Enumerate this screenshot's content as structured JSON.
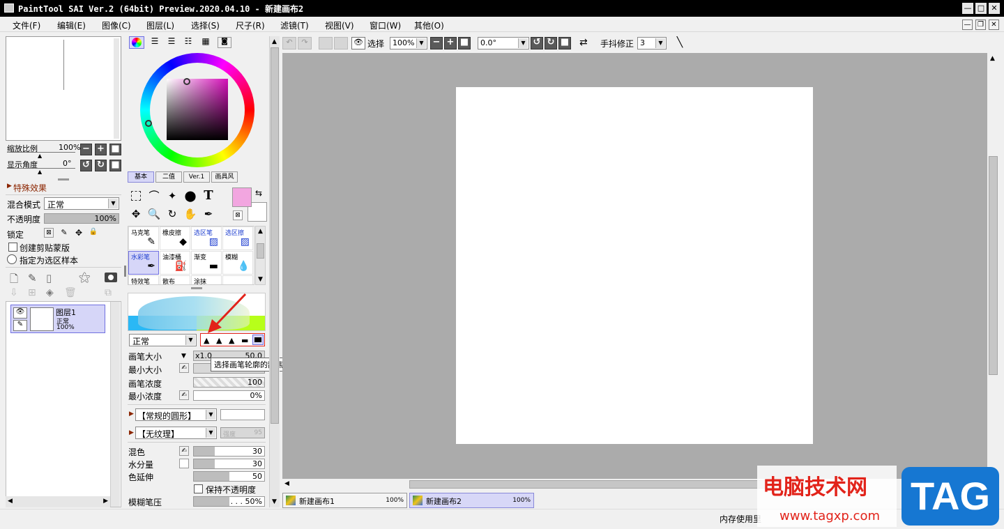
{
  "window": {
    "title": "PaintTool SAI Ver.2 (64bit) Preview.2020.04.10 - 新建画布2",
    "min": "—",
    "max": "□",
    "close": "✕"
  },
  "menu": [
    "文件(F)",
    "编辑(E)",
    "图像(C)",
    "图层(L)",
    "选择(S)",
    "尺子(R)",
    "滤镜(T)",
    "视图(V)",
    "窗口(W)",
    "其他(O)"
  ],
  "navigator": {
    "zoom_label": "缩放比例",
    "zoom_value": "100%",
    "angle_label": "显示角度",
    "angle_value": "0°"
  },
  "layer_panel": {
    "effects_label": "特殊效果",
    "blend_label": "混合模式",
    "blend_value": "正常",
    "opacity_label": "不透明度",
    "opacity_value": "100%",
    "opacity_level": 1.0,
    "lock_label": "锁定",
    "clip_label": "创建剪贴蒙版",
    "selection_source_label": "指定为选区样本",
    "layer": {
      "name": "图层1",
      "mode": "正常",
      "opacity": "100%"
    }
  },
  "color_panel": {
    "tabs": [
      "基本",
      "二值",
      "Ver.1",
      "画具风"
    ],
    "primary_color": "#f2a6e0",
    "secondary_color": "#ffffff"
  },
  "brushes": [
    {
      "label": "马克笔",
      "icon": "✎"
    },
    {
      "label": "橡皮擦",
      "icon": "◆"
    },
    {
      "label": "选区笔",
      "icon": "▨"
    },
    {
      "label": "选区擦",
      "icon": "▨"
    },
    {
      "label": "水彩笔",
      "icon": "✒"
    },
    {
      "label": "油漆桶",
      "icon": "⛽"
    },
    {
      "label": "渐变",
      "icon": "▬"
    },
    {
      "label": "模糊",
      "icon": "💧"
    },
    {
      "label": "特效笔",
      "icon": "✎"
    },
    {
      "label": "散布",
      "icon": "·"
    },
    {
      "label": "涂抹",
      "icon": "☜"
    },
    {
      "label": "",
      "icon": ""
    }
  ],
  "brush_settings": {
    "mode_value": "正常",
    "size_label": "画笔大小",
    "size_mult": "x1.0",
    "size_value": "50.0",
    "min_size_label": "最小大小",
    "density_label": "画笔浓度",
    "density_value": "100",
    "density_level": 1.0,
    "min_density_label": "最小浓度",
    "min_density_value": "0%",
    "shape_value": "【常规的圆形】",
    "texture_value": "【无纹理】",
    "texture_strength_label": "强度",
    "texture_strength_value": "95",
    "blend_label": "混色",
    "blend_value": "30",
    "blend_level": 0.3,
    "water_label": "水分量",
    "water_value": "30",
    "water_level": 0.3,
    "stretch_label": "色延伸",
    "stretch_value": "50",
    "stretch_level": 0.5,
    "keep_opacity_label": "保持不透明度",
    "blur_label": "模糊笔压",
    "blur_value": ". . . 50%",
    "blur_level": 0.5,
    "tooltip": "选择画笔轮廓的散焦程度。"
  },
  "toolbar": {
    "selection_label": "选择",
    "zoom_value": "100%",
    "angle_value": "0.0°",
    "stabilizer_label": "手抖修正",
    "stabilizer_value": "3"
  },
  "documents": [
    {
      "name": "新建画布1",
      "zoom": "100%"
    },
    {
      "name": "新建画布2",
      "zoom": "100%"
    }
  ],
  "status": {
    "memory_label": "内存使用里"
  },
  "watermark": {
    "text": "电脑技术网",
    "url": "www.tagxp.com",
    "tag": "TAG"
  }
}
